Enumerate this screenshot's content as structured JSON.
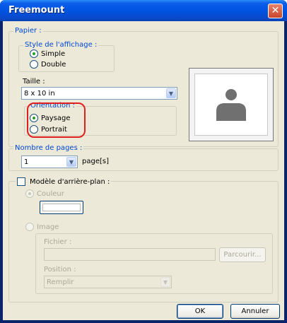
{
  "window": {
    "title": "Freemount",
    "close_glyph": "✕"
  },
  "papier": {
    "legend": "Papier :",
    "style_group": {
      "legend": "Style de l'affichage :",
      "options": [
        {
          "label": "Simple",
          "selected": true
        },
        {
          "label": "Double",
          "selected": false
        }
      ]
    },
    "taille": {
      "label": "Taille :",
      "value": "8 x 10 in"
    },
    "orientation": {
      "legend": "Orientation :",
      "options": [
        {
          "label": "Paysage",
          "selected": true
        },
        {
          "label": "Portrait",
          "selected": false
        }
      ]
    },
    "preview_icon": "person-icon"
  },
  "pages": {
    "legend": "Nombre de pages :",
    "value": "1",
    "unit": "page[s]"
  },
  "background": {
    "checkbox_label": "Modèle d'arrière-plan :",
    "checked": false,
    "couleur": {
      "label": "Couleur",
      "selected": true
    },
    "image": {
      "label": "Image",
      "selected": false,
      "fichier_label": "Fichier :",
      "fichier_value": "",
      "browse_label": "Parcourir...",
      "position_label": "Position :",
      "position_value": "Remplir"
    }
  },
  "buttons": {
    "ok": "OK",
    "cancel": "Annuler"
  },
  "colors": {
    "title_bar": "#0054e3",
    "face": "#ece9d8",
    "legend": "#0046d5",
    "highlight": "#e02020"
  }
}
